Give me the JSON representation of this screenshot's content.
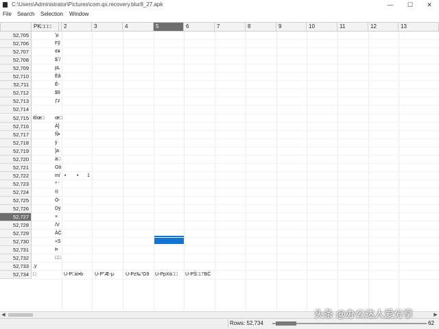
{
  "window": {
    "title": "C:\\Users\\Administrator\\Pictures\\com.qx.recovery.blur8_27.apk",
    "minimize": "—",
    "maximize": "☐",
    "close": "✕"
  },
  "menu": [
    "File",
    "Search",
    "Selection",
    "Window"
  ],
  "columns": [
    "PK□□□",
    "□",
    "2",
    "3",
    "4",
    "5",
    "6",
    "7",
    "8",
    "9",
    "10",
    "11",
    "12",
    "13"
  ],
  "selected_column": "5",
  "rows": [
    {
      "label": "52,705",
      "cells": [
        {
          "col": "c1",
          "text": "'μ"
        }
      ]
    },
    {
      "label": "52,706",
      "cells": [
        {
          "col": "c1",
          "text": "F|l"
        }
      ]
    },
    {
      "label": "52,707",
      "cells": [
        {
          "col": "c1",
          "text": "¢¥"
        }
      ]
    },
    {
      "label": "52,708",
      "cells": [
        {
          "col": "c1",
          "text": "$ˇ/"
        }
      ]
    },
    {
      "label": "52,709",
      "cells": [
        {
          "col": "c1",
          "text": "pL"
        }
      ]
    },
    {
      "label": "52,710",
      "cells": [
        {
          "col": "c1",
          "text": "Èâ"
        }
      ]
    },
    {
      "label": "52,711",
      "cells": [
        {
          "col": "c1",
          "text": "É-"
        }
      ]
    },
    {
      "label": "52,712",
      "cells": [
        {
          "col": "c1",
          "text": "$9"
        }
      ]
    },
    {
      "label": "52,713",
      "cells": [
        {
          "col": "c1",
          "text": "ƒz"
        }
      ]
    },
    {
      "label": "52,714",
      "cells": []
    },
    {
      "label": "52,715",
      "cells": [
        {
          "col": "c0",
          "text": "8Ìœ□"
        },
        {
          "col": "c1",
          "text": "œ□"
        }
      ]
    },
    {
      "label": "52,716",
      "cells": [
        {
          "col": "c1",
          "text": "À]"
        }
      ]
    },
    {
      "label": "52,717",
      "cells": [
        {
          "col": "c1",
          "text": "Ñ•"
        }
      ]
    },
    {
      "label": "52,718",
      "cells": [
        {
          "col": "c1",
          "text": "ý"
        }
      ]
    },
    {
      "label": "52,719",
      "cells": [
        {
          "col": "c1",
          "text": "]a·"
        }
      ]
    },
    {
      "label": "52,720",
      "cells": [
        {
          "col": "c1",
          "text": "à□"
        }
      ]
    },
    {
      "label": "52,721",
      "cells": [
        {
          "col": "c1",
          "text": "Oò"
        }
      ]
    },
    {
      "label": "52,722",
      "cells": [
        {
          "col": "c1",
          "text": "m/"
        },
        {
          "col": "c2",
          "text": "•"
        },
        {
          "col": "c3a",
          "text": "•"
        },
        {
          "col": "c3b",
          "text": "1"
        }
      ]
    },
    {
      "label": "52,723",
      "cells": [
        {
          "col": "c1",
          "text": "^ '"
        }
      ]
    },
    {
      "label": "52,724",
      "cells": [
        {
          "col": "c1",
          "text": "®"
        }
      ]
    },
    {
      "label": "52,725",
      "cells": [
        {
          "col": "c1",
          "text": "Ò-"
        }
      ]
    },
    {
      "label": "52,726",
      "cells": [
        {
          "col": "c1",
          "text": "Dÿ"
        }
      ]
    },
    {
      "label": "52,727",
      "cells": [
        {
          "col": "c1",
          "text": "×"
        }
      ]
    },
    {
      "label": "52,728",
      "cells": [
        {
          "col": "c1",
          "text": "/V"
        }
      ]
    },
    {
      "label": "52,729",
      "cells": [
        {
          "col": "c1",
          "text": "ÀČ"
        }
      ]
    },
    {
      "label": "52,730",
      "cells": [
        {
          "col": "c1",
          "text": "«S"
        }
      ]
    },
    {
      "label": "52,731",
      "cells": [
        {
          "col": "c1",
          "text": "Þ"
        }
      ]
    },
    {
      "label": "52,732",
      "cells": [
        {
          "col": "c1",
          "text": "□□"
        }
      ]
    },
    {
      "label": "52,733",
      "cells": [
        {
          "col": "c0",
          "text": ",y"
        }
      ]
    },
    {
      "label": "52,734",
      "cells": [
        {
          "col": "c0",
          "text": "□"
        },
        {
          "col": "c2w",
          "text": "U-P□ió•b"
        },
        {
          "col": "c3w",
          "text": "U-P\"Æ-μ·"
        },
        {
          "col": "c4w",
          "text": "U-Pz‰\"G9"
        },
        {
          "col": "c5w",
          "text": "U-PpXó□□"
        },
        {
          "col": "c6w",
          "text": "U-PŠ□□\"BČ"
        }
      ]
    }
  ],
  "selected_row": "52,727",
  "status": {
    "rows": "Rows: 52,734",
    "zoom": "62"
  },
  "watermark": "头条 @办公达人爱分享",
  "colors": {
    "selection": "#1474d4",
    "header_selected": "#6e6e6e"
  }
}
